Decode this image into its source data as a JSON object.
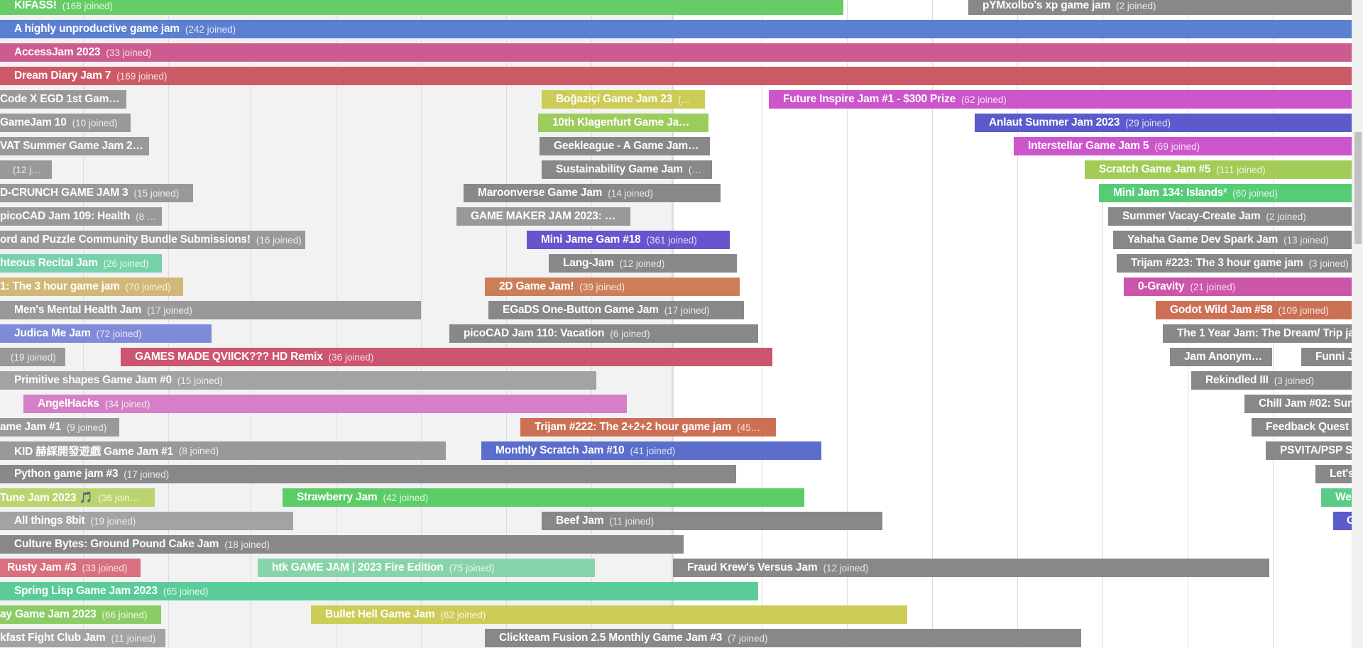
{
  "jams": [
    {
      "title": "KIFASS!",
      "joined": "(168 joined)",
      "color": "#66cc66"
    },
    {
      "title": "pYMxolbo's xp game jam",
      "joined": "(2 joined)",
      "color": "#888888"
    },
    {
      "title": "A highly unproductive game jam",
      "joined": "(242 joined)",
      "color": "#5b7fd1"
    },
    {
      "title": "AccessJam 2023",
      "joined": "(33 joined)",
      "color": "#cc5c8f"
    },
    {
      "title": "Dream Diary Jam 7",
      "joined": "(169 joined)",
      "color": "#cc5a66"
    },
    {
      "title": "Code X EGD 1st Gam…",
      "joined": "",
      "color": "#999999"
    },
    {
      "title": "Boğaziçi Game Jam 23",
      "joined": "(…",
      "color": "#cccc57"
    },
    {
      "title": "Future Inspire Jam #1 - $300 Prize",
      "joined": "(62 joined)",
      "color": "#cc55cc"
    },
    {
      "title": "GameJam 10",
      "joined": "(10 joined)",
      "color": "#999999"
    },
    {
      "title": "10th Klagenfurt Game Ja…",
      "joined": "",
      "color": "#9ccc5c"
    },
    {
      "title": "Anlaut Summer Jam 2023",
      "joined": "(29 joined)",
      "color": "#5b5bcc"
    },
    {
      "title": "VAT Summer Game Jam 2…",
      "joined": "",
      "color": "#999999"
    },
    {
      "title": "Geekleague - A Game Jam…",
      "joined": "",
      "color": "#888888"
    },
    {
      "title": "Interstellar Game Jam 5",
      "joined": "(69 joined)",
      "color": "#cc55cc"
    },
    {
      "title": "",
      "joined": "(12 j…",
      "color": "#999999"
    },
    {
      "title": "Sustainability Game Jam",
      "joined": "(…",
      "color": "#888888"
    },
    {
      "title": "Scratch Game Jam #5",
      "joined": "(111 joined)",
      "color": "#a3cc57"
    },
    {
      "title": "D-CRUNCH GAME JAM 3",
      "joined": "(15 joined)",
      "color": "#999999"
    },
    {
      "title": "Maroonverse Game Jam",
      "joined": "(14 joined)",
      "color": "#888888"
    },
    {
      "title": "Mini Jam 134: Islands²",
      "joined": "(60 joined)",
      "color": "#57cc77"
    },
    {
      "title": "picoCAD Jam 109: Health",
      "joined": "(8 …",
      "color": "#999999"
    },
    {
      "title": "GAME MAKER JAM 2023: …",
      "joined": "",
      "color": "#999999"
    },
    {
      "title": "Summer Vacay-Create Jam",
      "joined": "(2 joined)",
      "color": "#888888"
    },
    {
      "title": "ord and Puzzle Community Bundle Submissions!",
      "joined": "(16 joined)",
      "color": "#999999"
    },
    {
      "title": "Mini Jame Gam #18",
      "joined": "(361 joined)",
      "color": "#6655cc"
    },
    {
      "title": "Yahaha Game Dev Spark Jam",
      "joined": "(13 joined)",
      "color": "#888888"
    },
    {
      "title": "hteous Recital Jam",
      "joined": "(26 joined)",
      "color": "#77d1aa"
    },
    {
      "title": "Lang-Jam",
      "joined": "(12 joined)",
      "color": "#888888"
    },
    {
      "title": "Trijam #223: The 3 hour game jam",
      "joined": "(3 joined)",
      "color": "#888888"
    },
    {
      "title": "1: The 3 hour game jam",
      "joined": "(70 joined)",
      "color": "#d1b877"
    },
    {
      "title": "2D Game Jam!",
      "joined": "(39 joined)",
      "color": "#cc7f57"
    },
    {
      "title": "0-Gravity",
      "joined": "(21 joined)",
      "color": "#cc55aa"
    },
    {
      "title": "Men's Mental Health Jam",
      "joined": "(17 joined)",
      "color": "#999999"
    },
    {
      "title": "EGaDS One-Button Game Jam",
      "joined": "(17 joined)",
      "color": "#888888"
    },
    {
      "title": "Godot Wild Jam #58",
      "joined": "(109 joined)",
      "color": "#cc7055"
    },
    {
      "title": "Judica Me Jam",
      "joined": "(72 joined)",
      "color": "#7f8bd8"
    },
    {
      "title": "picoCAD Jam 110: Vacation",
      "joined": "(6 joined)",
      "color": "#888888"
    },
    {
      "title": "The 1 Year Jam: The Dream/ Trip ja",
      "joined": "",
      "color": "#888888"
    },
    {
      "title": "",
      "joined": "(19 joined)",
      "color": "#999999"
    },
    {
      "title": "GAMES MADE QVIICK??? HD Remix",
      "joined": "(36 joined)",
      "color": "#cc5570"
    },
    {
      "title": "Jam Anonym…",
      "joined": "",
      "color": "#888888"
    },
    {
      "title": "Funni J",
      "joined": "",
      "color": "#888888"
    },
    {
      "title": "Primitive shapes Game Jam #0",
      "joined": "(15 joined)",
      "color": "#a3a3a3"
    },
    {
      "title": "Rekindled III",
      "joined": "(3 joined)",
      "color": "#888888"
    },
    {
      "title": "AngelHacks",
      "joined": "(34 joined)",
      "color": "#d47fc7"
    },
    {
      "title": "Chill Jam #02: Sum",
      "joined": "",
      "color": "#888888"
    },
    {
      "title": "ame Jam #1",
      "joined": "(9 joined)",
      "color": "#999999"
    },
    {
      "title": "Trijam #222: The 2+2+2 hour game jam",
      "joined": "(45…",
      "color": "#cc7055"
    },
    {
      "title": "Feedback Quest",
      "joined": "",
      "color": "#888888"
    },
    {
      "title": "KID 赫綵開發遊戲 Game Jam #1",
      "joined": "(8 joined)",
      "color": "#999999"
    },
    {
      "title": "Monthly Scratch Jam #10",
      "joined": "(41 joined)",
      "color": "#5b6ecc"
    },
    {
      "title": "PSVITA/PSP S",
      "joined": "",
      "color": "#888888"
    },
    {
      "title": "Python game jam #3",
      "joined": "(17 joined)",
      "color": "#888888"
    },
    {
      "title": "Let's",
      "joined": "",
      "color": "#888888"
    },
    {
      "title": "Tune Jam 2023 🎵",
      "joined": "(36 join…",
      "color": "#bcd470"
    },
    {
      "title": "Strawberry Jam",
      "joined": "(42 joined)",
      "color": "#5bcc66"
    },
    {
      "title": "We",
      "joined": "",
      "color": "#5bcc88"
    },
    {
      "title": "All things 8bit",
      "joined": "(19 joined)",
      "color": "#a3a3a3"
    },
    {
      "title": "Beef Jam",
      "joined": "(11 joined)",
      "color": "#888888"
    },
    {
      "title": "G",
      "joined": "",
      "color": "#5b5bcc"
    },
    {
      "title": "Culture Bytes: Ground Pound Cake Jam",
      "joined": "(18 joined)",
      "color": "#888888"
    },
    {
      "title": "Rusty Jam #3",
      "joined": "(33 joined)",
      "color": "#d8707f"
    },
    {
      "title": "htk GAME JAM | 2023 Fire Edition",
      "joined": "(75 joined)",
      "color": "#88d4aa"
    },
    {
      "title": "Fraud Krew's Versus Jam",
      "joined": "(12 joined)",
      "color": "#888888"
    },
    {
      "title": "Spring Lisp Game Jam 2023",
      "joined": "(65 joined)",
      "color": "#5bcc99"
    },
    {
      "title": "ay Game Jam 2023",
      "joined": "(66 joined)",
      "color": "#8ccc66"
    },
    {
      "title": "Bullet Hell Game Jam",
      "joined": "(62 joined)",
      "color": "#cccc57"
    },
    {
      "title": "kfast Fight Club Jam",
      "joined": "(11 joined)",
      "color": "#a3a3a3"
    },
    {
      "title": "Clickteam Fusion 2.5 Monthly Game Jam #3",
      "joined": "(7 joined)",
      "color": "#888888"
    }
  ]
}
